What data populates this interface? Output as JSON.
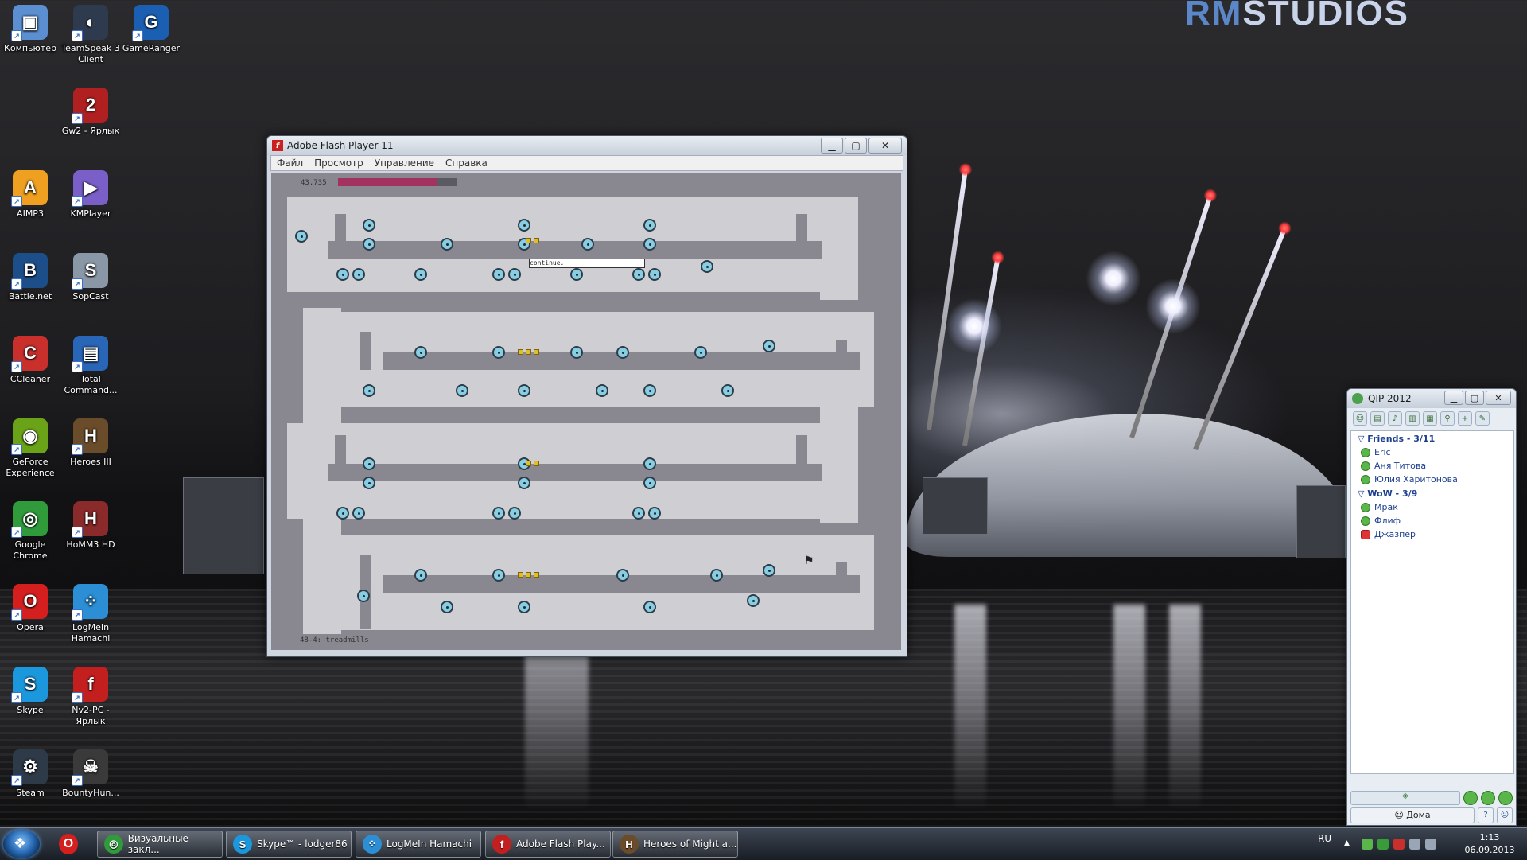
{
  "wallpaper": {
    "brand_prefix": "RM",
    "brand_suffix": "STUDIOS"
  },
  "desktop": {
    "icons": [
      {
        "label": "Компьютер",
        "icon": "computer-icon",
        "color": "#5b8fd1",
        "glyph": "▣"
      },
      {
        "label": "TeamSpeak 3 Client",
        "icon": "teamspeak-icon",
        "color": "#2e3b4e",
        "glyph": "◐"
      },
      {
        "label": "GameRanger",
        "icon": "gameranger-icon",
        "color": "#1b5fb3",
        "glyph": "G"
      },
      {
        "label": "Gw2 - Ярлык",
        "icon": "guildwars2-icon",
        "color": "#b02020",
        "glyph": "2"
      },
      {
        "label": "AIMP3",
        "icon": "aimp-icon",
        "color": "#f0a020",
        "glyph": "A"
      },
      {
        "label": "KMPlayer",
        "icon": "kmplayer-icon",
        "color": "#7a5fc9",
        "glyph": "▶"
      },
      {
        "label": "Battle.net",
        "icon": "battlenet-icon",
        "color": "#1c4f8a",
        "glyph": "B"
      },
      {
        "label": "SopCast",
        "icon": "sopcast-icon",
        "color": "#8a97a6",
        "glyph": "S"
      },
      {
        "label": "CCleaner",
        "icon": "ccleaner-icon",
        "color": "#c9302c",
        "glyph": "C"
      },
      {
        "label": "Total Command...",
        "icon": "totalcommander-icon",
        "color": "#2a66b8",
        "glyph": "▤"
      },
      {
        "label": "GeForce Experience",
        "icon": "geforce-icon",
        "color": "#6aa318",
        "glyph": "◉"
      },
      {
        "label": "Heroes III",
        "icon": "heroes3-icon",
        "color": "#6a4c2a",
        "glyph": "H"
      },
      {
        "label": "Google Chrome",
        "icon": "chrome-icon",
        "color": "#2f9b3a",
        "glyph": "◎"
      },
      {
        "label": "HoMM3 HD",
        "icon": "homm3hd-icon",
        "color": "#8a2a2a",
        "glyph": "H"
      },
      {
        "label": "Opera",
        "icon": "opera-icon",
        "color": "#d51f1f",
        "glyph": "O"
      },
      {
        "label": "LogMeIn Hamachi",
        "icon": "hamachi-icon",
        "color": "#2c8fd6",
        "glyph": "⁘"
      },
      {
        "label": "Skype",
        "icon": "skype-icon",
        "color": "#1b98dd",
        "glyph": "S"
      },
      {
        "label": "Nv2-PC - Ярлык",
        "icon": "flash-icon",
        "color": "#c41f1f",
        "glyph": "f"
      },
      {
        "label": "Steam",
        "icon": "steam-icon",
        "color": "#2e3a48",
        "glyph": "⚙"
      },
      {
        "label": "BountyHun...",
        "icon": "skull-icon",
        "color": "#3a3a3a",
        "glyph": "☠"
      }
    ]
  },
  "flash": {
    "title": "Adobe Flash Player 11",
    "menu": [
      "Файл",
      "Просмотр",
      "Управление",
      "Справка"
    ],
    "time": "43.735",
    "time_fraction": 0.83,
    "toast": "ouch... press JUMP to continue.",
    "level": "48-4: treadmills",
    "colors": {
      "bar": "#a3325f",
      "floor": "#cfcfd3",
      "bg": "#898790"
    }
  },
  "qip": {
    "title": "QIP 2012",
    "groups": [
      {
        "name": "Friends - 3/11",
        "contacts": [
          "Eric",
          "Аня Титова",
          "Юлия Харитонова"
        ]
      },
      {
        "name": "WoW - 3/9",
        "contacts": [
          "Мрак",
          "Флиф",
          "Джазпёр"
        ]
      }
    ],
    "status": "Дома"
  },
  "taskbar": {
    "items": [
      {
        "label": "Визуальные закл...",
        "icon": "chrome-icon",
        "color": "#2f9b3a",
        "glyph": "◎"
      },
      {
        "label": "Skype™ - lodger86",
        "icon": "skype-icon",
        "color": "#1b98dd",
        "glyph": "S"
      },
      {
        "label": "LogMeIn Hamachi",
        "icon": "hamachi-icon",
        "color": "#2c8fd6",
        "glyph": "⁘"
      },
      {
        "label": "Adobe Flash Play...",
        "icon": "flash-icon",
        "color": "#c41f1f",
        "glyph": "f"
      },
      {
        "label": "Heroes of Might a...",
        "icon": "heroes-icon",
        "color": "#6a4c2a",
        "glyph": "H"
      }
    ],
    "lang": "RU",
    "time": "1:13",
    "date": "06.09.2013"
  }
}
